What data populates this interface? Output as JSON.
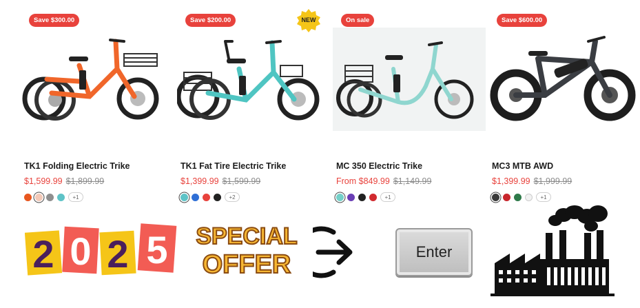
{
  "products": [
    {
      "badge": "Save $300.00",
      "title": "TK1 Folding Electric Trike",
      "price": "$1,599.99",
      "compare_price": "$1,899.99",
      "frame_color": "#f0662a",
      "swatches": [
        "#e8571f",
        "#f3c9b8",
        "#8f8f8f",
        "#5ec3c7"
      ],
      "selected_swatch": 1,
      "more_label": "+1"
    },
    {
      "badge": "Save $200.00",
      "new_label": "NEW",
      "title": "TK1 Fat Tire Electric Trike",
      "price": "$1,399.99",
      "compare_price": "$1,599.99",
      "frame_color": "#4fc5c2",
      "swatches": [
        "#5ec3c7",
        "#2f6fd6",
        "#e8423c",
        "#222222"
      ],
      "selected_swatch": 0,
      "more_label": "+2"
    },
    {
      "badge": "On sale",
      "title": "MC 350 Electric Trike",
      "price": "From $849.99",
      "compare_price": "$1,149.99",
      "frame_color": "#8fd6cf",
      "swatches": [
        "#74d0c9",
        "#6a3fb5",
        "#222222",
        "#d12a2f"
      ],
      "selected_swatch": 0,
      "more_label": "+1"
    },
    {
      "badge": "Save $600.00",
      "title": "MC3 MTB AWD",
      "price": "$1,399.99",
      "compare_price": "$1,999.99",
      "frame_color": "#3a3d42",
      "swatches": [
        "#3a3a3a",
        "#c8262c",
        "#2f7a4a",
        "#f2f2f2"
      ],
      "selected_swatch": 0,
      "more_label": "+1"
    }
  ],
  "promo": {
    "year_digits": [
      "2",
      "0",
      "2",
      "5"
    ],
    "offer_line1": "SPECIAL",
    "offer_line2": "OFFER",
    "enter_key_label": "Enter"
  },
  "colors": {
    "sale_red": "#e8423c",
    "new_badge_yellow": "#f5c518"
  },
  "icons": [
    "new-badge-icon",
    "enter-arrow-icon",
    "enter-key-icon",
    "factory-icon"
  ]
}
